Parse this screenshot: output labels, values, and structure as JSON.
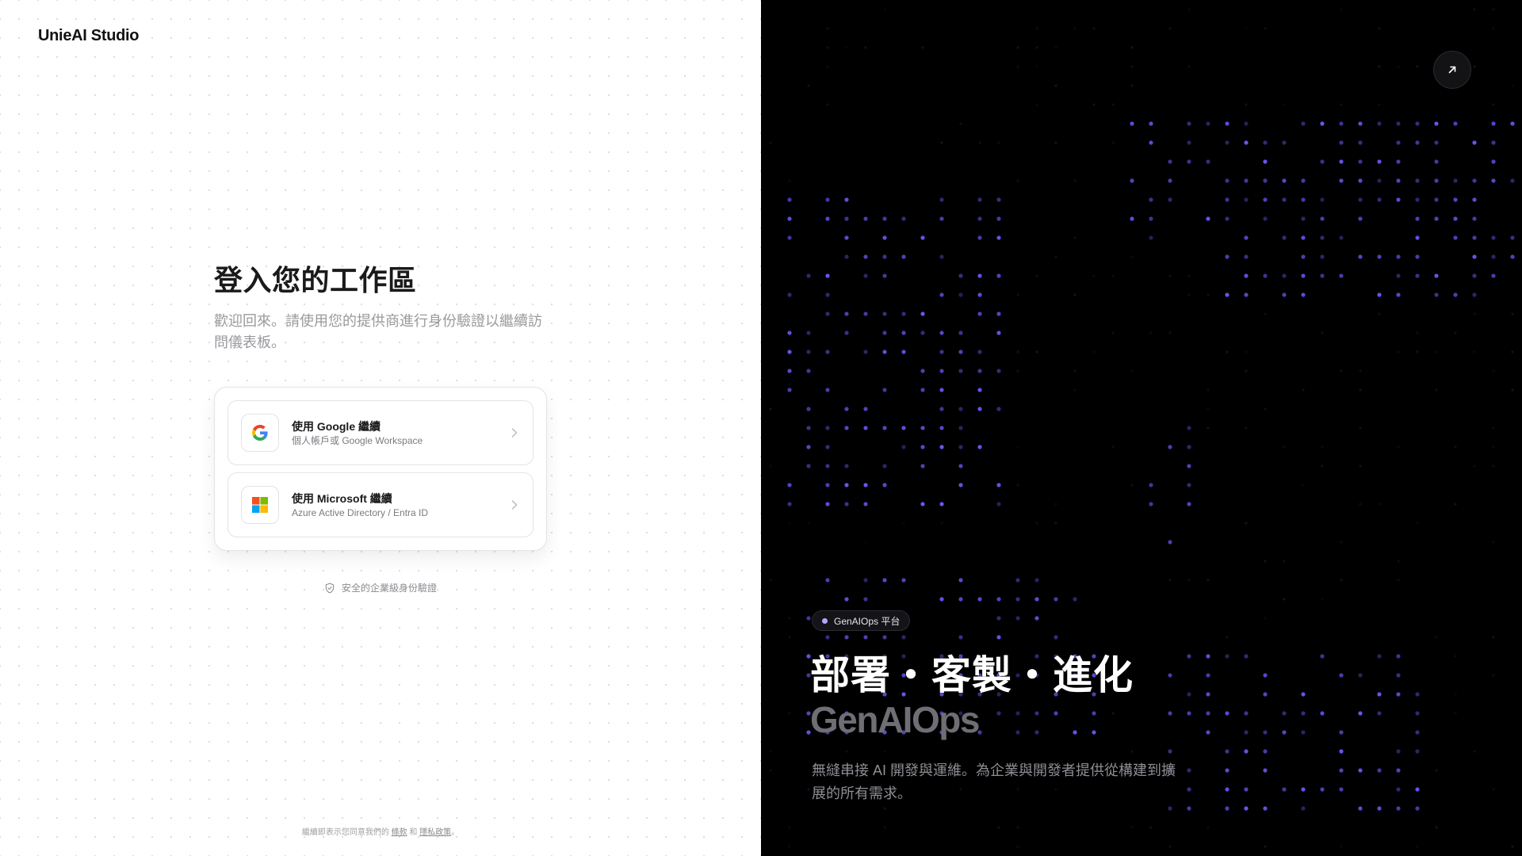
{
  "brand": {
    "name": "UnieAI Studio"
  },
  "login": {
    "title": "登入您的工作區",
    "subtitle": "歡迎回來。請使用您的提供商進行身份驗證以繼續訪問儀表板。",
    "providers": [
      {
        "title": "使用 Google 繼續",
        "subtitle": "個人帳戶或 Google Workspace",
        "icon": "google-logo-icon"
      },
      {
        "title": "使用 Microsoft 繼續",
        "subtitle": "Azure Active Directory / Entra ID",
        "icon": "microsoft-logo-icon"
      }
    ],
    "secure_note": "安全的企業級身份驗證"
  },
  "footer": {
    "prefix": "繼續即表示您同意我們的",
    "terms": "條款",
    "conjunction": "和",
    "privacy": "隱私政策",
    "suffix": "。"
  },
  "hero": {
    "badge": "GenAIOps 平台",
    "title": "部署・客製・進化",
    "subtitle": "GenAIOps",
    "description": "無縫串接 AI 開發與運維。為企業與開發者提供從構建到擴展的所有需求。",
    "arrow_icon": "arrow-up-right-icon"
  },
  "colors": {
    "accent": "#6a5cff",
    "badge_dot": "#b3a6ff",
    "dark_bg": "#000000"
  }
}
